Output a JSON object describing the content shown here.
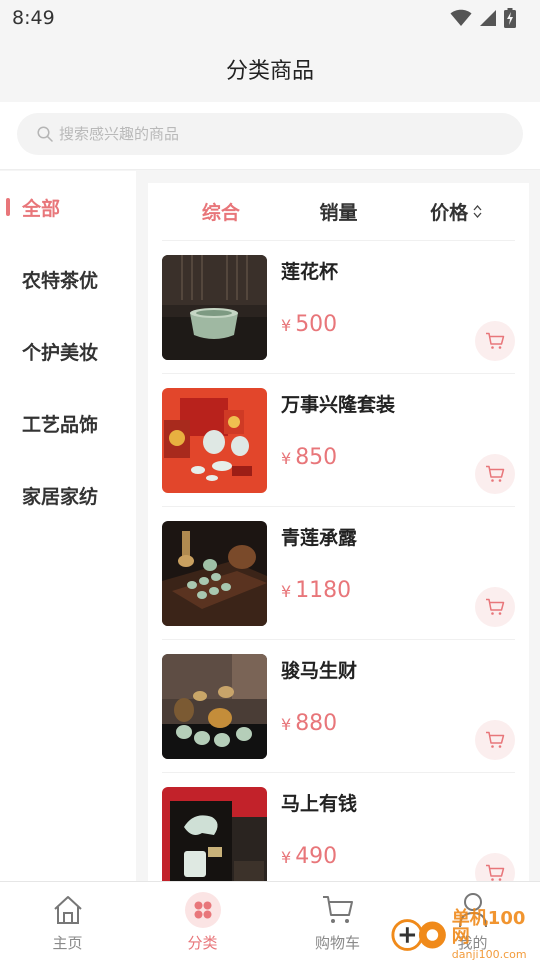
{
  "status": {
    "time": "8:49"
  },
  "header": {
    "title": "分类商品"
  },
  "search": {
    "placeholder": "搜索感兴趣的商品"
  },
  "categories": [
    {
      "label": "全部",
      "active": true
    },
    {
      "label": "农特茶优"
    },
    {
      "label": "个护美妆"
    },
    {
      "label": "工艺品饰"
    },
    {
      "label": "家居家纺"
    }
  ],
  "sort": [
    {
      "label": "综合",
      "active": true
    },
    {
      "label": "销量"
    },
    {
      "label": "价格",
      "icon": "sort-updown-icon"
    }
  ],
  "currency": "¥",
  "products": [
    {
      "name": "莲花杯",
      "price": "500",
      "image": "celadon-cup"
    },
    {
      "name": "万事兴隆套装",
      "price": "850",
      "image": "red-gift-tea-set"
    },
    {
      "name": "青莲承露",
      "price": "1180",
      "image": "celadon-tea-set-tray"
    },
    {
      "name": "骏马生财",
      "price": "880",
      "image": "horse-tea-set"
    },
    {
      "name": "马上有钱",
      "price": "490",
      "image": "horse-figurine-box"
    }
  ],
  "tabbar": [
    {
      "label": "主页",
      "icon": "home-icon"
    },
    {
      "label": "分类",
      "icon": "category-icon",
      "active": true
    },
    {
      "label": "购物车",
      "icon": "cart-icon"
    },
    {
      "label": "我的",
      "icon": "user-icon"
    }
  ],
  "watermark": {
    "main": "单机100网",
    "sub": "danji100.com"
  },
  "colors": {
    "accent": "#e8767a",
    "accent_bg": "#fbeeee",
    "background": "#f5f5f5"
  }
}
